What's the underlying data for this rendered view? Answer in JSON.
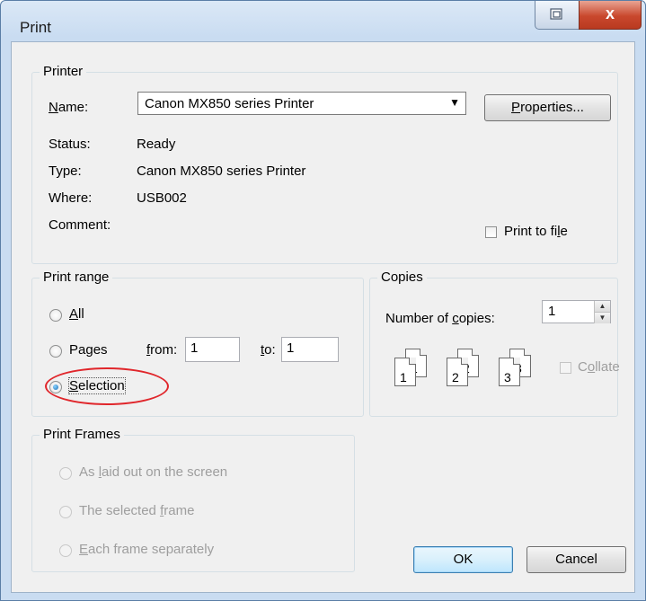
{
  "window": {
    "title": "Print",
    "close_glyph": "x",
    "restore_icon": "restore-icon"
  },
  "printer": {
    "legend": "Printer",
    "name_label": "Name:",
    "name_value": "Canon MX850 series Printer",
    "properties_label": "Properties...",
    "status_label": "Status:",
    "status_value": "Ready",
    "type_label": "Type:",
    "type_value": "Canon MX850 series Printer",
    "where_label": "Where:",
    "where_value": "USB002",
    "comment_label": "Comment:",
    "print_to_file_label": "Print to file"
  },
  "print_range": {
    "legend": "Print range",
    "all_label": "All",
    "pages_label": "Pages",
    "from_label": "from:",
    "from_value": "1",
    "to_label": "to:",
    "to_value": "1",
    "selection_label": "Selection",
    "selected": "Selection"
  },
  "copies": {
    "legend": "Copies",
    "number_label": "Number of copies:",
    "number_value": "1",
    "collate_label": "Collate",
    "collate_pages": [
      {
        "back": "1",
        "front": "1"
      },
      {
        "back": "2",
        "front": "2"
      },
      {
        "back": "3",
        "front": "3"
      }
    ]
  },
  "print_frames": {
    "legend": "Print Frames",
    "options": [
      "As laid out on the screen",
      "The selected frame",
      "Each frame separately"
    ]
  },
  "buttons": {
    "ok": "OK",
    "cancel": "Cancel"
  },
  "colors": {
    "annotation_circle": "#e0262b",
    "title_bar": "#c9dcf1",
    "close_button": "#c9482d"
  }
}
